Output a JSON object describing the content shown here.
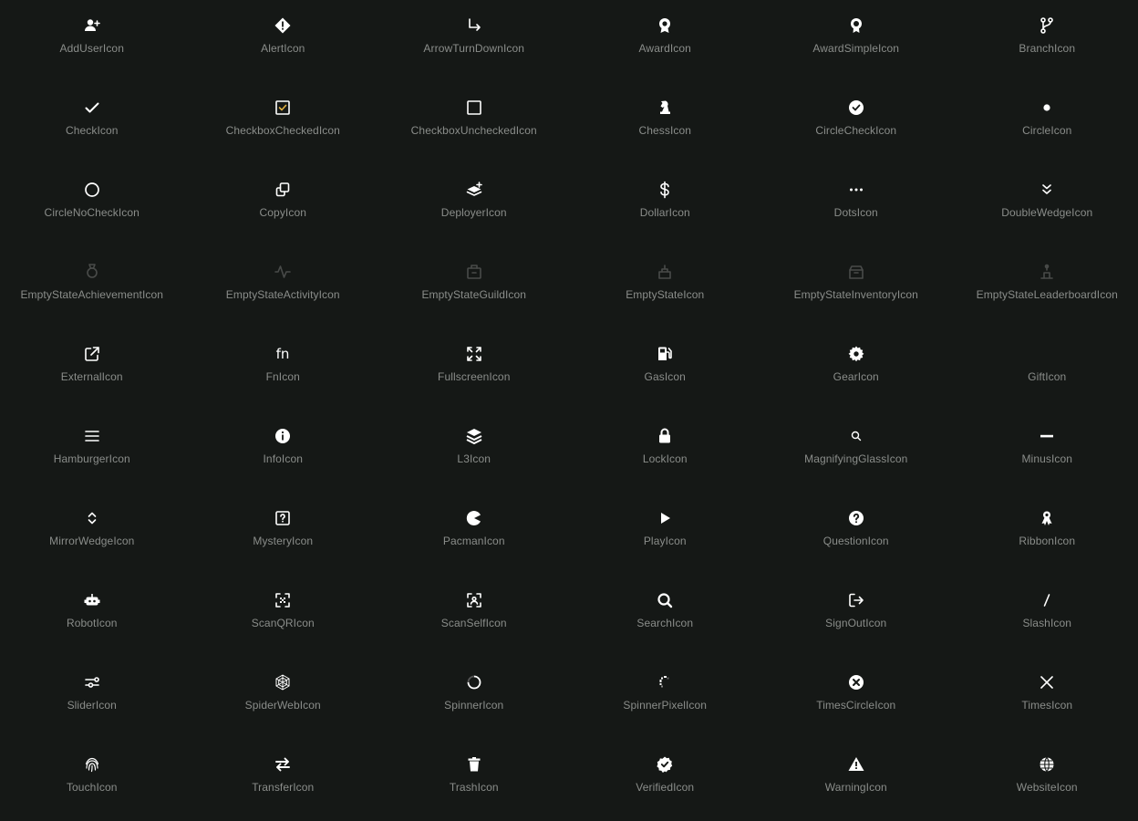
{
  "colors": {
    "background": "#151816",
    "icon": "#ffffff",
    "label": "#8a8d8a",
    "check_accent": "#e3b341"
  },
  "icons": [
    {
      "name": "add-user-icon",
      "label": "AddUserIcon"
    },
    {
      "name": "alert-icon",
      "label": "AlertIcon"
    },
    {
      "name": "arrow-turn-down-icon",
      "label": "ArrowTurnDownIcon"
    },
    {
      "name": "award-icon",
      "label": "AwardIcon"
    },
    {
      "name": "award-simple-icon",
      "label": "AwardSimpleIcon"
    },
    {
      "name": "branch-icon",
      "label": "BranchIcon"
    },
    {
      "name": "check-icon",
      "label": "CheckIcon"
    },
    {
      "name": "checkbox-checked-icon",
      "label": "CheckboxCheckedIcon"
    },
    {
      "name": "checkbox-unchecked-icon",
      "label": "CheckboxUncheckedIcon"
    },
    {
      "name": "chess-icon",
      "label": "ChessIcon"
    },
    {
      "name": "circle-check-icon",
      "label": "CircleCheckIcon"
    },
    {
      "name": "circle-icon",
      "label": "CircleIcon"
    },
    {
      "name": "circle-no-check-icon",
      "label": "CircleNoCheckIcon"
    },
    {
      "name": "copy-icon",
      "label": "CopyIcon"
    },
    {
      "name": "deployer-icon",
      "label": "DeployerIcon"
    },
    {
      "name": "dollar-icon",
      "label": "DollarIcon"
    },
    {
      "name": "dots-icon",
      "label": "DotsIcon"
    },
    {
      "name": "double-wedge-icon",
      "label": "DoubleWedgeIcon"
    },
    {
      "name": "empty-state-achievement-icon",
      "label": "EmptyStateAchievementIcon"
    },
    {
      "name": "empty-state-activity-icon",
      "label": "EmptyStateActivityIcon"
    },
    {
      "name": "empty-state-guild-icon",
      "label": "EmptyStateGuildIcon"
    },
    {
      "name": "empty-state-icon",
      "label": "EmptyStateIcon"
    },
    {
      "name": "empty-state-inventory-icon",
      "label": "EmptyStateInventoryIcon"
    },
    {
      "name": "empty-state-leaderboard-icon",
      "label": "EmptyStateLeaderboardIcon"
    },
    {
      "name": "external-icon",
      "label": "ExternalIcon"
    },
    {
      "name": "fn-icon",
      "label": "FnIcon"
    },
    {
      "name": "fullscreen-icon",
      "label": "FullscreenIcon"
    },
    {
      "name": "gas-icon",
      "label": "GasIcon"
    },
    {
      "name": "gear-icon",
      "label": "GearIcon"
    },
    {
      "name": "gift-icon",
      "label": "GiftIcon"
    },
    {
      "name": "hamburger-icon",
      "label": "HamburgerIcon"
    },
    {
      "name": "info-icon",
      "label": "InfoIcon"
    },
    {
      "name": "l3-icon",
      "label": "L3Icon"
    },
    {
      "name": "lock-icon",
      "label": "LockIcon"
    },
    {
      "name": "magnifying-glass-icon",
      "label": "MagnifyingGlassIcon"
    },
    {
      "name": "minus-icon",
      "label": "MinusIcon"
    },
    {
      "name": "mirror-wedge-icon",
      "label": "MirrorWedgeIcon"
    },
    {
      "name": "mystery-icon",
      "label": "MysteryIcon"
    },
    {
      "name": "pacman-icon",
      "label": "PacmanIcon"
    },
    {
      "name": "play-icon",
      "label": "PlayIcon"
    },
    {
      "name": "question-icon",
      "label": "QuestionIcon"
    },
    {
      "name": "ribbon-icon",
      "label": "RibbonIcon"
    },
    {
      "name": "robot-icon",
      "label": "RobotIcon"
    },
    {
      "name": "scan-qr-icon",
      "label": "ScanQRIcon"
    },
    {
      "name": "scan-self-icon",
      "label": "ScanSelfIcon"
    },
    {
      "name": "search-icon",
      "label": "SearchIcon"
    },
    {
      "name": "sign-out-icon",
      "label": "SignOutIcon"
    },
    {
      "name": "slash-icon",
      "label": "SlashIcon"
    },
    {
      "name": "slider-icon",
      "label": "SliderIcon"
    },
    {
      "name": "spider-web-icon",
      "label": "SpiderWebIcon"
    },
    {
      "name": "spinner-icon",
      "label": "SpinnerIcon"
    },
    {
      "name": "spinner-pixel-icon",
      "label": "SpinnerPixelIcon"
    },
    {
      "name": "times-circle-icon",
      "label": "TimesCircleIcon"
    },
    {
      "name": "times-icon",
      "label": "TimesIcon"
    },
    {
      "name": "touch-icon",
      "label": "TouchIcon"
    },
    {
      "name": "transfer-icon",
      "label": "TransferIcon"
    },
    {
      "name": "trash-icon",
      "label": "TrashIcon"
    },
    {
      "name": "verified-icon",
      "label": "VerifiedIcon"
    },
    {
      "name": "warning-icon",
      "label": "WarningIcon"
    },
    {
      "name": "website-icon",
      "label": "WebsiteIcon"
    }
  ]
}
